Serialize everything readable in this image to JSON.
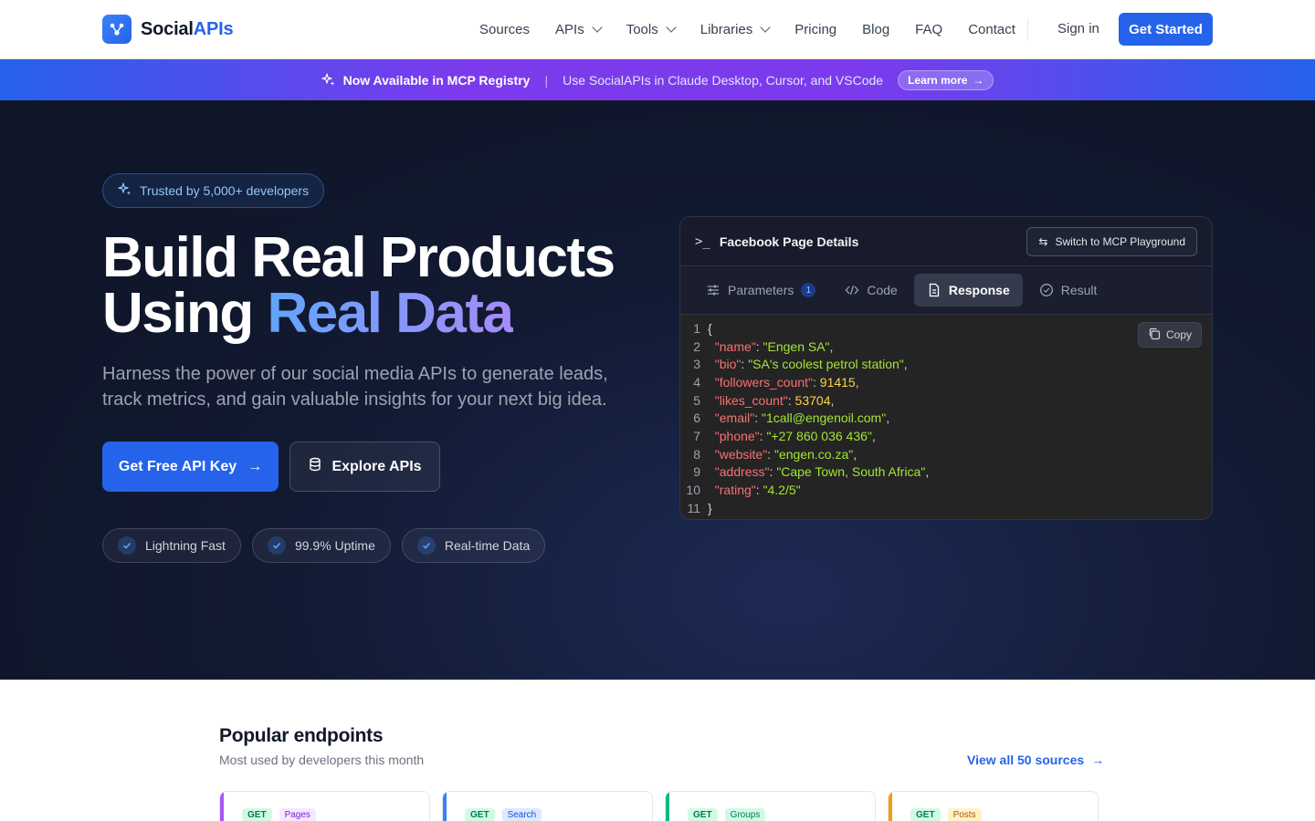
{
  "header": {
    "logo_main": "Social",
    "logo_accent": "APIs",
    "nav": [
      {
        "label": "Sources",
        "dropdown": false
      },
      {
        "label": "APIs",
        "dropdown": true
      },
      {
        "label": "Tools",
        "dropdown": true
      },
      {
        "label": "Libraries",
        "dropdown": true
      },
      {
        "label": "Pricing",
        "dropdown": false
      },
      {
        "label": "Blog",
        "dropdown": false
      },
      {
        "label": "FAQ",
        "dropdown": false
      },
      {
        "label": "Contact",
        "dropdown": false
      }
    ],
    "signin": "Sign in",
    "cta": "Get Started"
  },
  "banner": {
    "title": "Now Available in MCP Registry",
    "separator": "|",
    "message": "Use SocialAPIs in Claude Desktop, Cursor, and VSCode",
    "link": "Learn more"
  },
  "hero": {
    "trust": "Trusted by 5,000+ developers",
    "title_line1": "Build Real Products",
    "title_line2_plain": "Using ",
    "title_line2_accent": "Real Data",
    "subtitle": "Harness the power of our social media APIs to generate leads, track metrics, and gain valuable insights for your next big idea.",
    "primary_cta": "Get Free API Key",
    "secondary_cta": "Explore APIs",
    "features": [
      "Lightning Fast",
      "99.9% Uptime",
      "Real-time Data"
    ]
  },
  "panel": {
    "title": "Facebook Page Details",
    "mcp_button": "Switch to MCP Playground",
    "tabs": [
      {
        "label": "Parameters",
        "count": "1",
        "active": false,
        "icon": "sliders-icon"
      },
      {
        "label": "Code",
        "count": "",
        "active": false,
        "icon": "code-icon"
      },
      {
        "label": "Response",
        "count": "",
        "active": true,
        "icon": "document-icon"
      },
      {
        "label": "Result",
        "count": "",
        "active": false,
        "icon": "check-circle-icon"
      }
    ],
    "copy": "Copy",
    "json_lines": [
      {
        "n": "1",
        "key": "",
        "value": "",
        "type": "open"
      },
      {
        "n": "2",
        "key": "\"name\"",
        "value": "\"Engen SA\"",
        "type": "string"
      },
      {
        "n": "3",
        "key": "\"bio\"",
        "value": "\"SA's coolest petrol station\"",
        "type": "string"
      },
      {
        "n": "4",
        "key": "\"followers_count\"",
        "value": "91415",
        "type": "number"
      },
      {
        "n": "5",
        "key": "\"likes_count\"",
        "value": "53704",
        "type": "number"
      },
      {
        "n": "6",
        "key": "\"email\"",
        "value": "\"1call@engenoil.com\"",
        "type": "string"
      },
      {
        "n": "7",
        "key": "\"phone\"",
        "value": "\"+27 860 036 436\"",
        "type": "string"
      },
      {
        "n": "8",
        "key": "\"website\"",
        "value": "\"engen.co.za\"",
        "type": "string"
      },
      {
        "n": "9",
        "key": "\"address\"",
        "value": "\"Cape Town, South Africa\"",
        "type": "string"
      },
      {
        "n": "10",
        "key": "\"rating\"",
        "value": "\"4.2/5\"",
        "type": "last"
      },
      {
        "n": "11",
        "key": "",
        "value": "",
        "type": "close"
      }
    ]
  },
  "popular": {
    "title": "Popular endpoints",
    "subtitle": "Most used by developers this month",
    "view_all": "View all 50 sources",
    "cards": [
      {
        "method": "GET",
        "category": "Pages",
        "stripe": "#a855f7",
        "cat_color": "#7e22ce",
        "cat_bg": "#f3e8ff"
      },
      {
        "method": "GET",
        "category": "Search",
        "stripe": "#3b82f6",
        "cat_color": "#1d4ed8",
        "cat_bg": "#dbeafe"
      },
      {
        "method": "GET",
        "category": "Groups",
        "stripe": "#10b981",
        "cat_color": "#047857",
        "cat_bg": "#d1fae5"
      },
      {
        "method": "GET",
        "category": "Posts",
        "stripe": "#f59e0b",
        "cat_color": "#b45309",
        "cat_bg": "#fef3c7"
      }
    ]
  },
  "colors": {
    "brand": "#2563eb",
    "hero_bg": "#121a33",
    "banner_from": "#2563eb",
    "banner_mid": "#7c3aed"
  }
}
